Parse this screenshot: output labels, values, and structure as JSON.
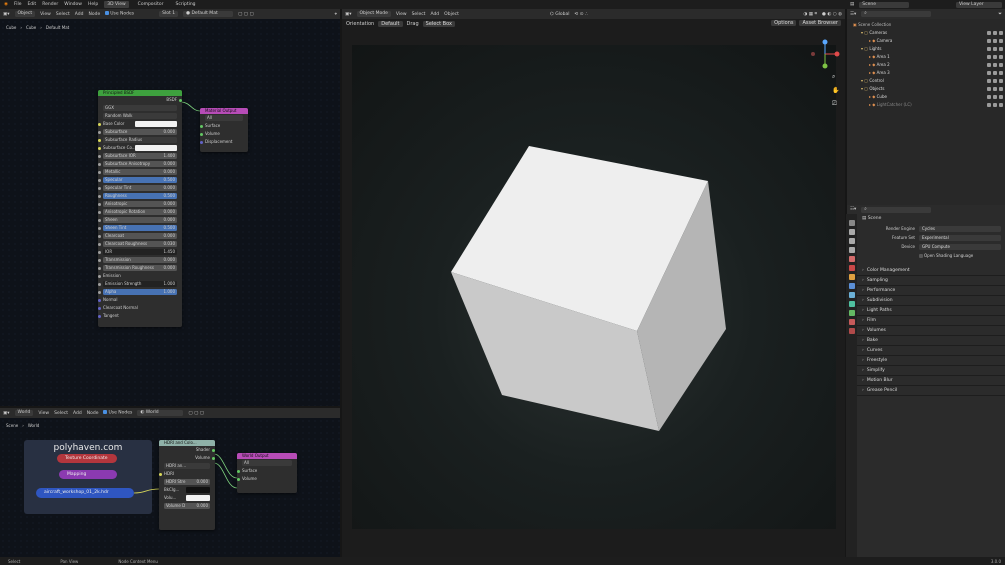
{
  "topbar": {
    "menus": [
      "File",
      "Edit",
      "Render",
      "Window",
      "Help"
    ],
    "tabs": [
      "3D View",
      "Compositor",
      "Scripting"
    ],
    "active_tab": "3D View"
  },
  "shader_editor": {
    "header": {
      "mode": "Object",
      "menus": [
        "View",
        "Select",
        "Add",
        "Node"
      ],
      "use_nodes": "Use Nodes",
      "slot": "Slot 1",
      "material": "Default Mat"
    },
    "breadcrumb": [
      "Cube",
      "Cube",
      "Default Mat"
    ],
    "principled": {
      "title": "Principled BSDF",
      "output": "BSDF",
      "dist": "GGX",
      "sss_method": "Random Walk",
      "rows": [
        {
          "label": "Base Color",
          "type": "color"
        },
        {
          "label": "Subsurface",
          "value": "0.000",
          "type": "num"
        },
        {
          "label": "Subsurface Radius",
          "type": "sel"
        },
        {
          "label": "Subsurface Co...",
          "type": "color"
        },
        {
          "label": "Subsurface IOR",
          "value": "1.400",
          "type": "num"
        },
        {
          "label": "Subsurface Anisotropy",
          "value": "0.000",
          "type": "num"
        },
        {
          "label": "Metallic",
          "value": "0.000",
          "type": "num"
        },
        {
          "label": "Specular",
          "value": "0.500",
          "type": "blue"
        },
        {
          "label": "Specular Tint",
          "value": "0.000",
          "type": "num"
        },
        {
          "label": "Roughness",
          "value": "0.500",
          "type": "blue"
        },
        {
          "label": "Anisotropic",
          "value": "0.000",
          "type": "num"
        },
        {
          "label": "Anisotropic Rotation",
          "value": "0.000",
          "type": "num"
        },
        {
          "label": "Sheen",
          "value": "0.000",
          "type": "num"
        },
        {
          "label": "Sheen Tint",
          "value": "0.500",
          "type": "blue"
        },
        {
          "label": "Clearcoat",
          "value": "0.000",
          "type": "num"
        },
        {
          "label": "Clearcoat Roughness",
          "value": "0.030",
          "type": "num"
        },
        {
          "label": "IOR",
          "value": "1.450",
          "type": "dark"
        },
        {
          "label": "Transmission",
          "value": "0.000",
          "type": "num"
        },
        {
          "label": "Transmission Roughness",
          "value": "0.000",
          "type": "num"
        },
        {
          "label": "Emission",
          "type": "plain"
        },
        {
          "label": "Emission Strength",
          "value": "1.000",
          "type": "dark"
        },
        {
          "label": "Alpha",
          "value": "1.000",
          "type": "blue"
        },
        {
          "label": "Normal",
          "type": "plain"
        },
        {
          "label": "Clearcoat Normal",
          "type": "plain"
        },
        {
          "label": "Tangent",
          "type": "plain"
        }
      ]
    },
    "material_output": {
      "title": "Material Output",
      "target": "All",
      "inputs": [
        "Surface",
        "Volume",
        "Displacement"
      ]
    }
  },
  "world_editor": {
    "header": {
      "mode": "World",
      "menus": [
        "View",
        "Select",
        "Add",
        "Node"
      ],
      "use_nodes": "Use Nodes",
      "world": "World"
    },
    "breadcrumb": [
      "Scene",
      "World"
    ],
    "frame_label": "polyhaven.com",
    "texcoord": "Texture Coordinate",
    "mapping": "Mapping",
    "hdri_file": "aircraft_workshop_01_2k.hdr",
    "hdri_node": {
      "title": "HDRI and Colo...",
      "outputs": [
        "Shader",
        "Volume"
      ],
      "image": "HDRI an...",
      "rows": [
        "HDRI",
        "HDRI Stre",
        "BkClg...",
        "Volu...",
        "Volume D"
      ],
      "values": [
        "",
        "0.000",
        "",
        "",
        "0.000"
      ]
    },
    "world_output": {
      "title": "World Output",
      "target": "All",
      "inputs": [
        "Surface",
        "Volume"
      ]
    }
  },
  "viewport": {
    "header": {
      "mode": "Object Mode",
      "menus": [
        "View",
        "Select",
        "Add",
        "Object"
      ],
      "transform": "Global"
    },
    "subheader": {
      "orientation_label": "Orientation",
      "orientation": "Default",
      "drag_label": "Drag",
      "drag": "Select Box",
      "options": "Options",
      "asset_browser": "Asset Browser"
    }
  },
  "outliner": {
    "header": {
      "scene": "Scene",
      "view_layer": "View Layer"
    },
    "rows": [
      {
        "label": "Scene Collection",
        "indent": 0,
        "color": "#bbbbbb"
      },
      {
        "label": "Cameras",
        "indent": 1,
        "color": "#d9d9d9"
      },
      {
        "label": "Camera",
        "indent": 2,
        "color": "#d9d9d9"
      },
      {
        "label": "Lights",
        "indent": 1,
        "color": "#d9d9d9"
      },
      {
        "label": "Area 1",
        "indent": 2,
        "color": "#d9d9d9"
      },
      {
        "label": "Area 2",
        "indent": 2,
        "color": "#d9d9d9"
      },
      {
        "label": "Area 3",
        "indent": 2,
        "color": "#d9d9d9"
      },
      {
        "label": "Control",
        "indent": 1,
        "color": "#d9d9d9"
      },
      {
        "label": "Objects",
        "indent": 1,
        "color": "#d9d9d9"
      },
      {
        "label": "Cube",
        "indent": 2,
        "color": "#d9d9d9"
      },
      {
        "label": "LightCatcher (LC)",
        "indent": 2,
        "color": "#8a8a8a"
      }
    ]
  },
  "properties": {
    "scene": "Scene",
    "render_engine_label": "Render Engine",
    "render_engine": "Cycles",
    "feature_set_label": "Feature Set",
    "feature_set": "Experimental",
    "device_label": "Device",
    "device": "GPU Compute",
    "osl": "Open Shading Language",
    "panels": [
      "Color Management",
      "Sampling",
      "Performance",
      "Subdivision",
      "Light Paths",
      "Film",
      "Volumes",
      "Bake",
      "Curves",
      "Freestyle",
      "Simplify",
      "Motion Blur",
      "Grease Pencil"
    ]
  },
  "status": {
    "select": "Select",
    "pan": "Pan View",
    "context": "Node Context Menu",
    "version": "3.0.0"
  },
  "colors": {
    "principled_header": "#3ea13e",
    "output_header": "#b74cb7",
    "hdri_header": "#8fb1a8",
    "texcoord": "#b3363d",
    "mapping": "#8b3ab1",
    "image": "#2f56c1",
    "accent": "#4a90e2"
  }
}
